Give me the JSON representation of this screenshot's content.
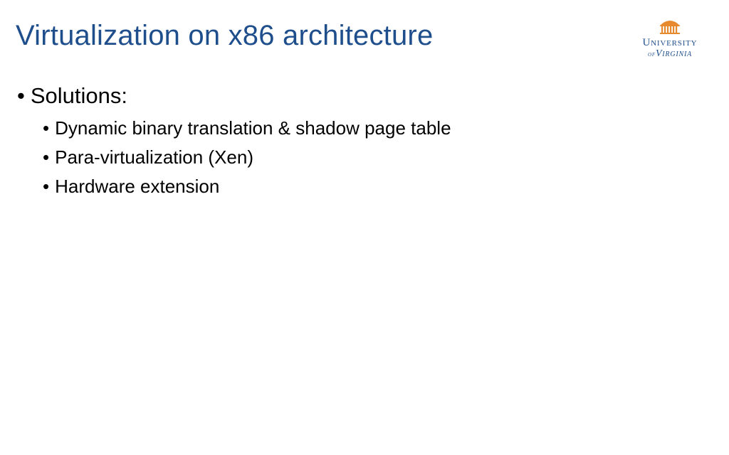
{
  "title": "Virtualization on x86 architecture",
  "logo": {
    "line1": "University",
    "of": "of",
    "line2": "Virginia"
  },
  "content": {
    "heading": "Solutions:",
    "items": [
      "Dynamic binary translation & shadow page table",
      "Para-virtualization (Xen)",
      "Hardware extension"
    ]
  }
}
